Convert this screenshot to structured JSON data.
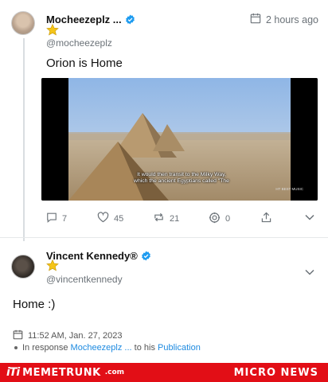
{
  "post1": {
    "author_name": "Mocheezeplz ...",
    "handle": "@mocheezeplz",
    "time": "2 hours ago",
    "text": "Orion is Home",
    "video_caption": "It would then transit to the Milky Way, which the ancient Egyptians called \"The",
    "video_watermark": "HT BEST MUSIC",
    "actions": {
      "replies": "7",
      "likes": "45",
      "reposts": "21",
      "views": "0"
    }
  },
  "post2": {
    "author_name": "Vincent Kennedy®",
    "handle": "@vincentkennedy",
    "text": "Home :)",
    "timestamp": "11:52 AM, Jan. 27, 2023",
    "response_prefix": "In response",
    "response_user": "Mocheezeplz ...",
    "response_mid": "to his",
    "response_link": "Publication"
  },
  "footer": {
    "brand_mark": "iTi",
    "brand_name": "MEMETRUNK",
    "brand_tld": ".com",
    "right_label": "MICRO NEWS"
  },
  "colors": {
    "verified": "#1d9bf0",
    "star": "#f5c518",
    "link": "#1d8ae0",
    "footer_bg": "#e20e16"
  }
}
